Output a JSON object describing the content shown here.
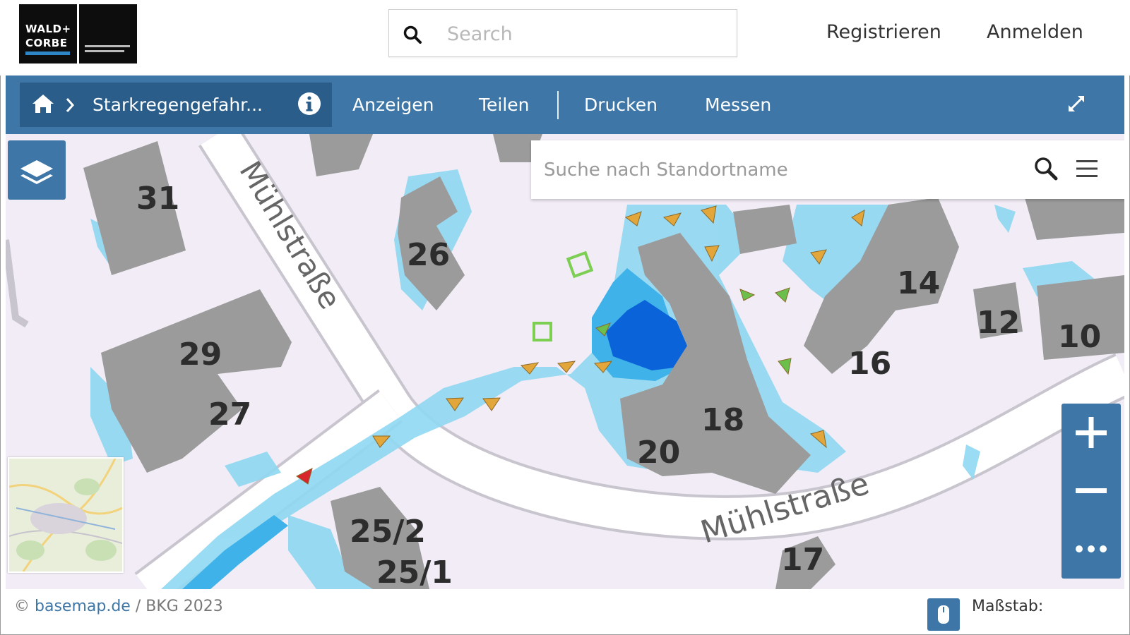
{
  "header": {
    "logo_line1": "WALD+",
    "logo_line2": "CORBE",
    "search_placeholder": "Search",
    "register_label": "Registrieren",
    "login_label": "Anmelden"
  },
  "toolbar": {
    "breadcrumb_title": "Starkregengefahr...",
    "show_label": "Anzeigen",
    "share_label": "Teilen",
    "print_label": "Drucken",
    "measure_label": "Messen"
  },
  "map": {
    "location_search_placeholder": "Suche nach Standortname",
    "street_labels": [
      "Mühlstraße",
      "Mühlstraße"
    ],
    "house_numbers": [
      "31",
      "26",
      "29",
      "27",
      "14",
      "12",
      "10",
      "16",
      "18",
      "20",
      "25/2",
      "25/1",
      "17"
    ],
    "colors": {
      "background": "#f1ecf5",
      "building": "#9b9b9b",
      "water_light": "#8fd8f2",
      "water_medium": "#3fb2ea",
      "water_deep": "#0a63d8",
      "arrow_orange": "#e2a63a",
      "arrow_green": "#6cbf4b",
      "arrow_red": "#d8262b",
      "control_blue": "#3e77a7"
    }
  },
  "footer": {
    "attribution_prefix": "©",
    "attribution_link": "basemap.de",
    "attribution_suffix": "/ BKG 2023",
    "scale_label": "Maßstab:"
  }
}
